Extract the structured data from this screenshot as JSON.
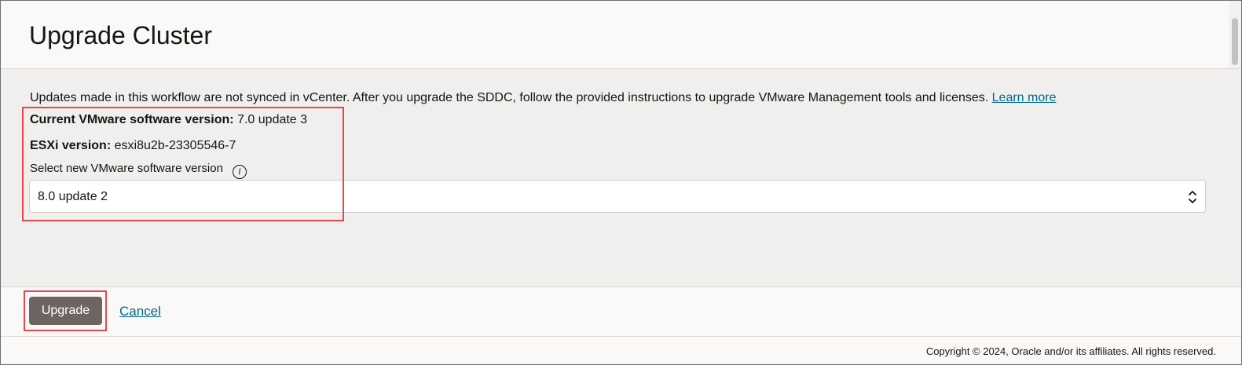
{
  "header": {
    "title": "Upgrade Cluster"
  },
  "notice": {
    "text": "Updates made in this workflow are not synced in vCenter. After you upgrade the SDDC, follow the provided instructions to upgrade VMware Management tools and licenses.",
    "link_label": "Learn more"
  },
  "current_version": {
    "label": "Current VMware software version:",
    "value": "7.0 update 3"
  },
  "esxi_version": {
    "label": "ESXi version:",
    "value": "esxi8u2b-23305546-7"
  },
  "version_select": {
    "label": "Select new VMware software version",
    "info_icon": "info-icon",
    "selected_value": "8.0 update 2",
    "chevron_icon": "up-down-chevron-icon"
  },
  "actions": {
    "upgrade_label": "Upgrade",
    "cancel_label": "Cancel"
  },
  "footer": {
    "copyright": "Copyright © 2024, Oracle and/or its affiliates. All rights reserved."
  },
  "colors": {
    "highlight": "#e5474c",
    "primary_button": "#6e6461",
    "link": "#00688c"
  }
}
